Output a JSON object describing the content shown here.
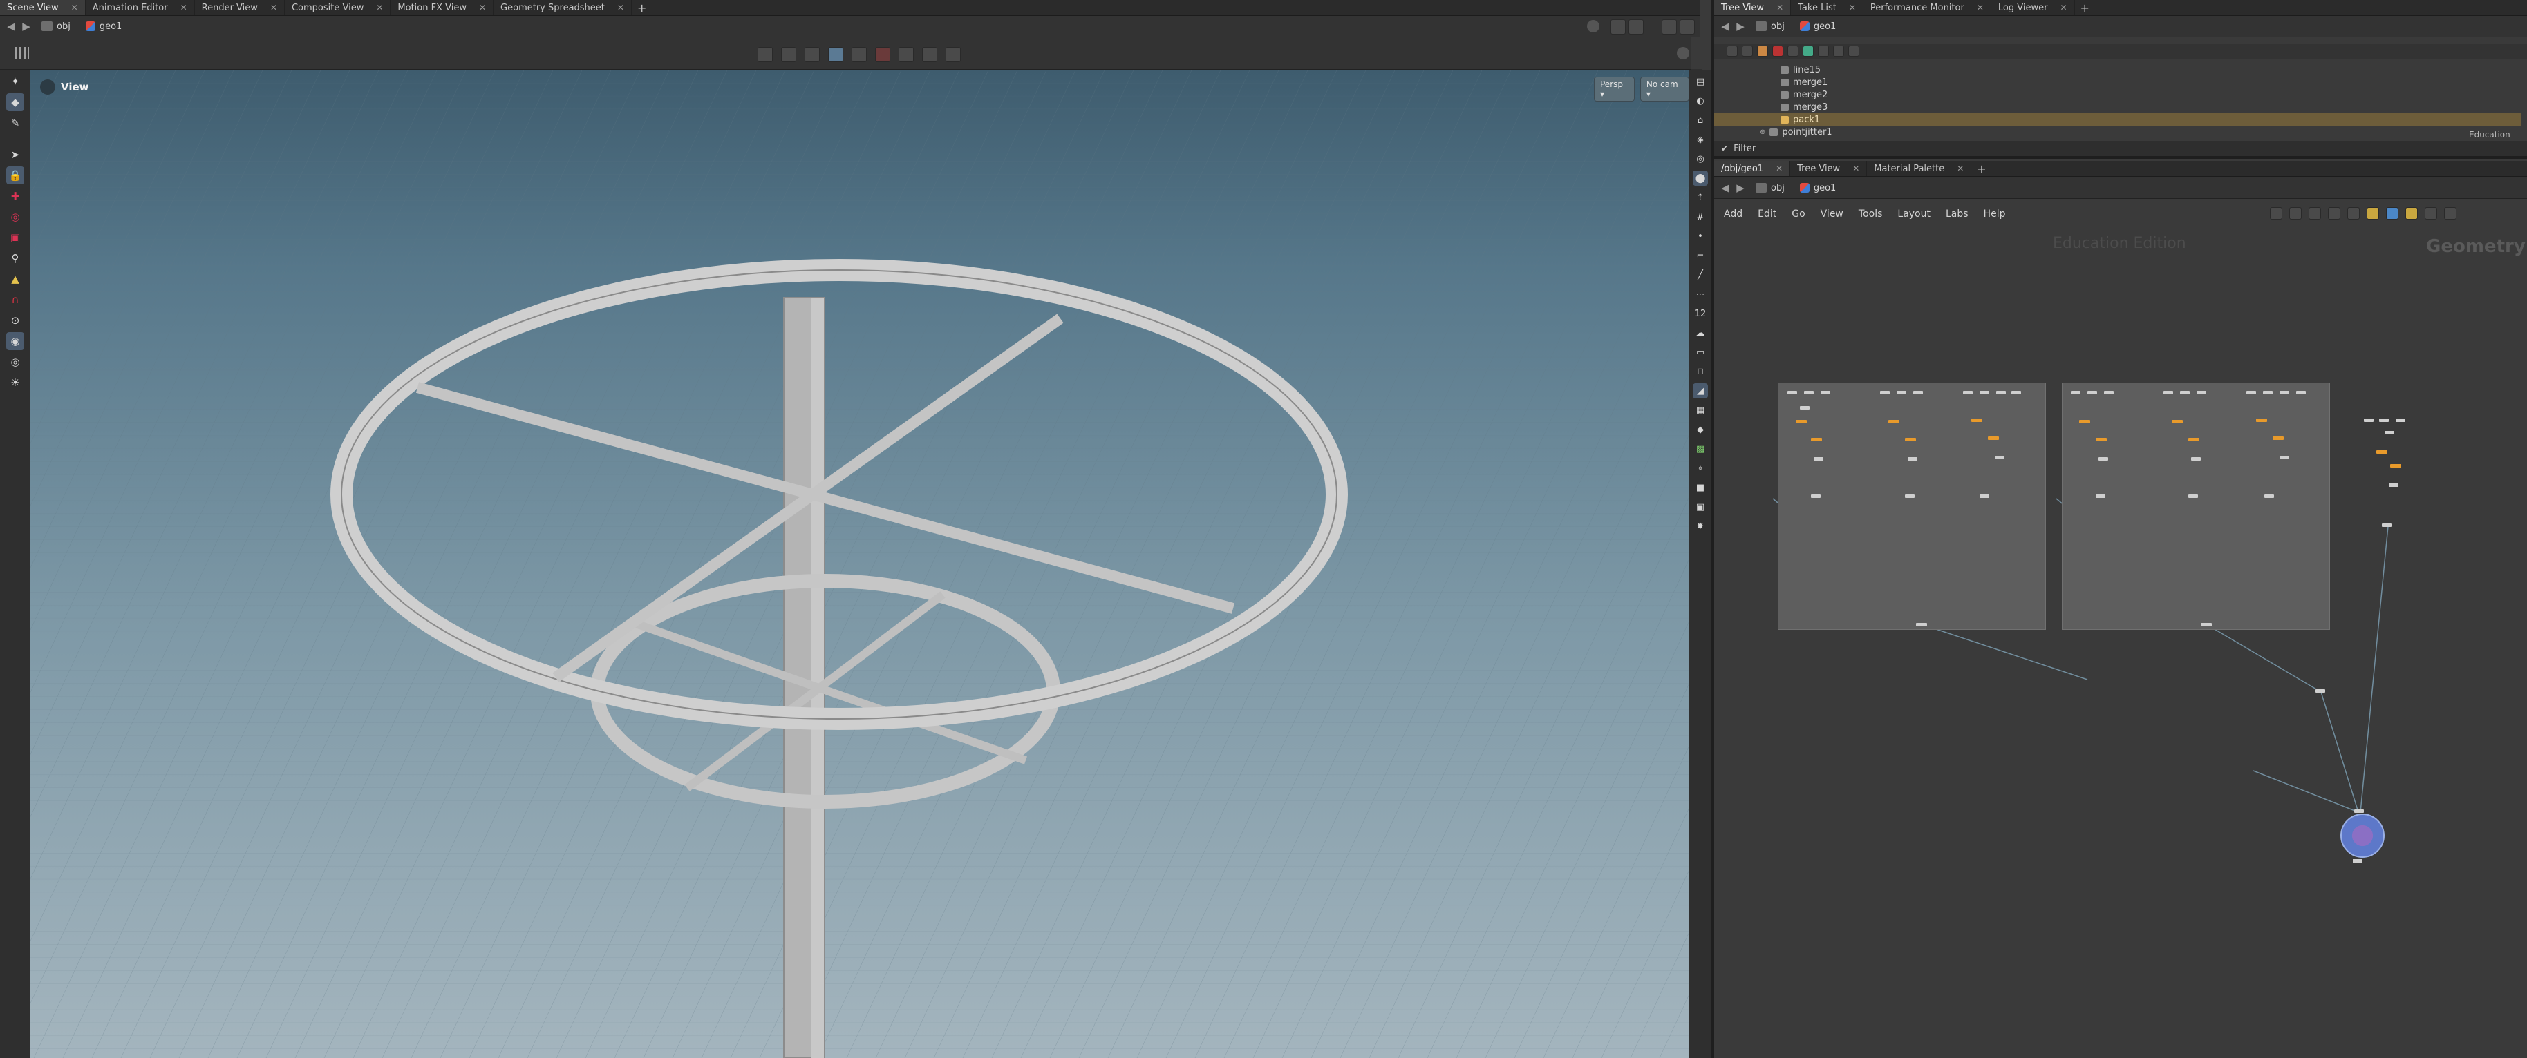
{
  "left_pane": {
    "tabs": [
      "Scene View",
      "Animation Editor",
      "Render View",
      "Composite View",
      "Motion FX View",
      "Geometry Spreadsheet"
    ],
    "path": {
      "root": "obj",
      "node": "geo1"
    },
    "viewport": {
      "title": "View",
      "camera_persp": "Persp ▾",
      "camera_cam": "No cam ▾"
    }
  },
  "tree_pane": {
    "tabs": [
      "Tree View",
      "Take List",
      "Performance Monitor",
      "Log Viewer"
    ],
    "path": {
      "root": "obj",
      "node": "geo1"
    },
    "rows": [
      "line15",
      "merge1",
      "merge2",
      "merge3",
      "pack1",
      "pointjitter1"
    ],
    "selected_row": "pack1",
    "education_label": "Education",
    "filter_label": "Filter"
  },
  "net_pane": {
    "tabs": [
      "/obj/geo1",
      "Tree View",
      "Material Palette"
    ],
    "path": {
      "root": "obj",
      "node": "geo1"
    },
    "menu": [
      "Add",
      "Edit",
      "Go",
      "View",
      "Tools",
      "Layout",
      "Labs",
      "Help"
    ],
    "watermark": "Education Edition",
    "context_label": "Geometry"
  },
  "colors": {
    "accent_orange": "#e89a2b",
    "selection_blue": "#4b5b6e",
    "tree_selected": "#6d5d3a",
    "output_node": "#6a7fd0"
  }
}
